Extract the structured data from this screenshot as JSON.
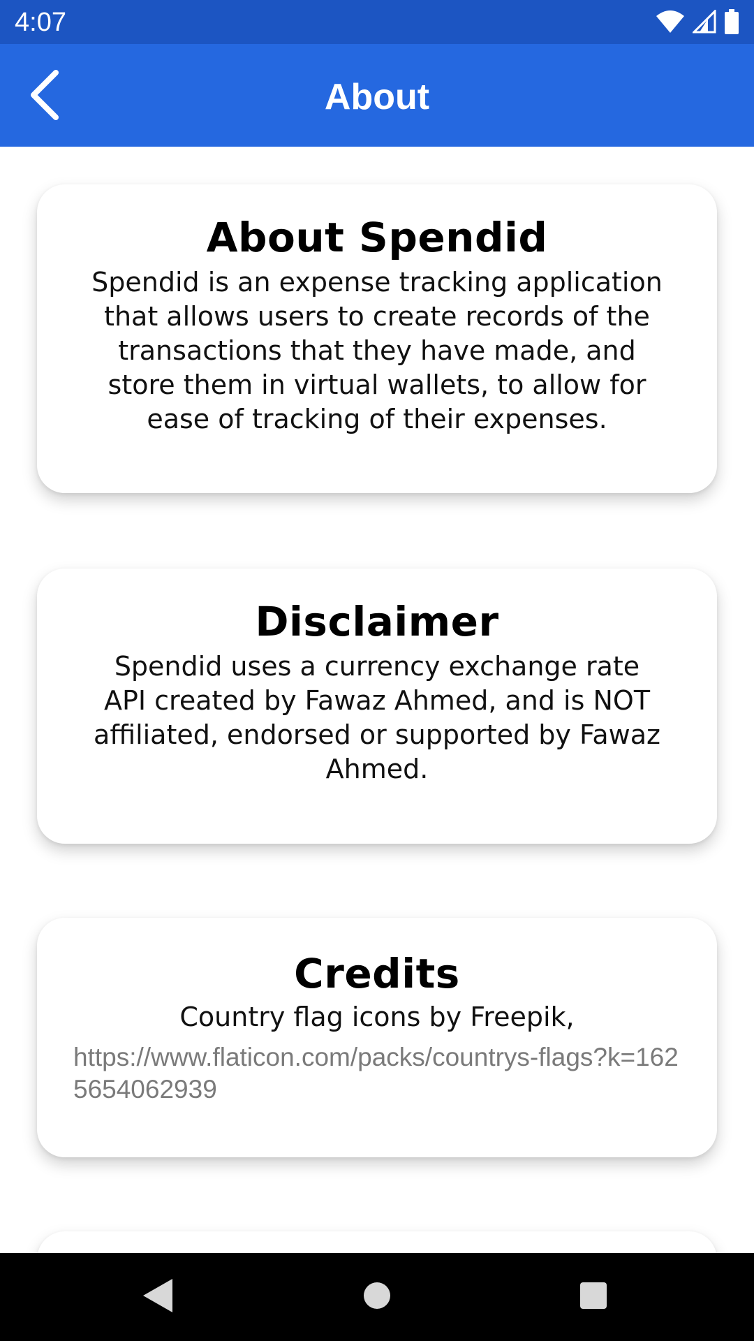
{
  "status_bar": {
    "time": "4:07"
  },
  "app_bar": {
    "title": "About"
  },
  "cards": [
    {
      "title": "About Spendid",
      "body": "Spendid is an expense tracking application that allows users to create records of the transactions that they have made, and store them in virtual wallets, to allow for ease of tracking of their expenses."
    },
    {
      "title": "Disclaimer",
      "body": "Spendid uses a currency exchange rate API created by Fawaz Ahmed, and is NOT affiliated, endorsed or supported by Fawaz Ahmed."
    },
    {
      "title": "Credits",
      "body": "Country flag icons by Freepik,",
      "link": "https://www.flaticon.com/packs/countrys-flags?k=1625654062939"
    }
  ],
  "colors": {
    "status_bar": "#1c55c2",
    "app_bar": "#2568e0",
    "link": "#7a7a7a"
  },
  "icons": {
    "back": "arrow-back-icon",
    "wifi": "wifi-icon",
    "signal": "cell-signal-icon",
    "battery": "battery-icon",
    "nav_back": "nav-back-icon",
    "nav_home": "nav-home-icon",
    "nav_recents": "nav-recents-icon"
  }
}
